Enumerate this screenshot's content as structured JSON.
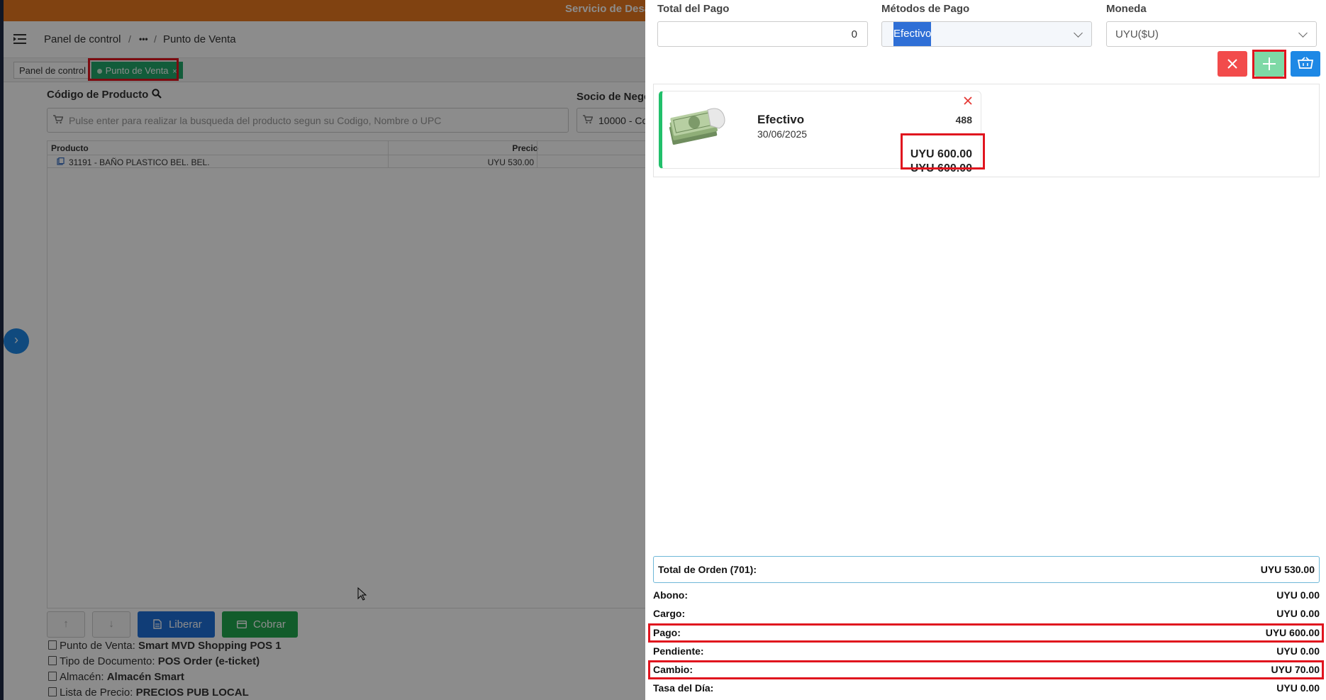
{
  "app": {
    "banner_text": "Servicio de Desa"
  },
  "breadcrumb": {
    "items": [
      "Panel de control",
      "Punto de Venta"
    ],
    "separator": "/",
    "ellipsis": "•••"
  },
  "tabs": [
    {
      "label": "Panel de control",
      "active": false
    },
    {
      "label": "Punto de Venta",
      "active": true,
      "close": "×"
    }
  ],
  "product_search": {
    "label": "Código de Producto",
    "placeholder": "Pulse enter para realizar la busqueda del producto segun su Codigo, Nombre o UPC"
  },
  "partner": {
    "label": "Socio de Nego",
    "value": "10000 - Co"
  },
  "product_table": {
    "columns": [
      "Producto",
      "Precio"
    ],
    "rows": [
      {
        "product": "31191 - BAÑO PLASTICO BEL. BEL.",
        "price": "UYU 530.00"
      }
    ]
  },
  "actions": {
    "up_icon": "↑",
    "down_icon": "↓",
    "release_label": "Liberar",
    "charge_label": "Cobrar"
  },
  "pos_info": [
    {
      "label": "Punto de Venta:",
      "value": "Smart MVD Shopping POS 1"
    },
    {
      "label": "Tipo de Documento:",
      "value": "POS Order (e-ticket)"
    },
    {
      "label": "Almacén:",
      "value": "Almacén Smart"
    },
    {
      "label": "Lista de Precio:",
      "value": "PRECIOS PUB LOCAL"
    }
  ],
  "payment_form": {
    "total_label": "Total del Pago",
    "total_value": "0",
    "method_label": "Métodos de Pago",
    "method_value": "Efectivo",
    "currency_label": "Moneda",
    "currency_value": "UYU($U)"
  },
  "payment_buttons": {
    "cancel_color": "#f24b4b",
    "add_color": "#7ed9a6",
    "cart_color": "#1e88e5"
  },
  "payment_card": {
    "method": "Efectivo",
    "date": "30/06/2025",
    "number": "488",
    "amount_1": "UYU 600.00",
    "amount_2": "UYU 600.00"
  },
  "summary": {
    "order_total_label": "Total de Orden (701):",
    "order_total_value": "UYU 530.00",
    "rows": [
      {
        "label": "Abono:",
        "value": "UYU 0.00"
      },
      {
        "label": "Cargo:",
        "value": "UYU 0.00"
      },
      {
        "label": "Pago:",
        "value": "UYU 600.00"
      },
      {
        "label": "Pendiente:",
        "value": "UYU 0.00"
      },
      {
        "label": "Cambio:",
        "value": "UYU 70.00"
      },
      {
        "label": "Tasa del Día:",
        "value": "UYU 0.00"
      }
    ]
  },
  "colors": {
    "banner": "#e9781f",
    "highlight_border": "#e0141e",
    "active_tab": "#21a86a",
    "release_button": "#1e6fd9",
    "charge_button": "#21a84f"
  }
}
